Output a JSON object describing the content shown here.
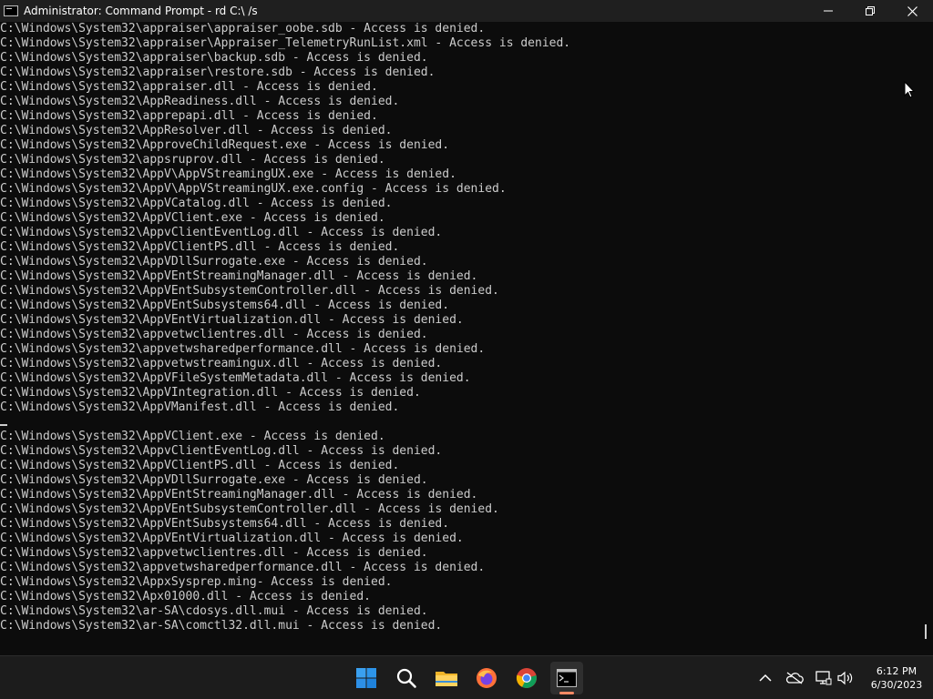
{
  "window": {
    "title": "Administrator: Command Prompt - rd  C:\\ /s",
    "controls": [
      "minimize-icon",
      "maximize-icon",
      "close-icon"
    ]
  },
  "console": {
    "lines_block1": [
      "C:\\Windows\\System32\\appraiser\\appraiser_oobe.sdb - Access is denied.",
      "C:\\Windows\\System32\\appraiser\\Appraiser_TelemetryRunList.xml - Access is denied.",
      "C:\\Windows\\System32\\appraiser\\backup.sdb - Access is denied.",
      "C:\\Windows\\System32\\appraiser\\restore.sdb - Access is denied.",
      "C:\\Windows\\System32\\appraiser.dll - Access is denied.",
      "C:\\Windows\\System32\\AppReadiness.dll - Access is denied.",
      "C:\\Windows\\System32\\apprepapi.dll - Access is denied.",
      "C:\\Windows\\System32\\AppResolver.dll - Access is denied.",
      "C:\\Windows\\System32\\ApproveChildRequest.exe - Access is denied.",
      "C:\\Windows\\System32\\appsruprov.dll - Access is denied.",
      "C:\\Windows\\System32\\AppV\\AppVStreamingUX.exe - Access is denied.",
      "C:\\Windows\\System32\\AppV\\AppVStreamingUX.exe.config - Access is denied.",
      "C:\\Windows\\System32\\AppVCatalog.dll - Access is denied.",
      "C:\\Windows\\System32\\AppVClient.exe - Access is denied.",
      "C:\\Windows\\System32\\AppvClientEventLog.dll - Access is denied.",
      "C:\\Windows\\System32\\AppVClientPS.dll - Access is denied.",
      "C:\\Windows\\System32\\AppVDllSurrogate.exe - Access is denied.",
      "C:\\Windows\\System32\\AppVEntStreamingManager.dll - Access is denied.",
      "C:\\Windows\\System32\\AppVEntSubsystemController.dll - Access is denied.",
      "C:\\Windows\\System32\\AppVEntSubsystems64.dll - Access is denied.",
      "C:\\Windows\\System32\\AppVEntVirtualization.dll - Access is denied.",
      "C:\\Windows\\System32\\appvetwclientres.dll - Access is denied.",
      "C:\\Windows\\System32\\appvetwsharedperformance.dll - Access is denied.",
      "C:\\Windows\\System32\\appvetwstreamingux.dll - Access is denied.",
      "C:\\Windows\\System32\\AppVFileSystemMetadata.dll - Access is denied.",
      "C:\\Windows\\System32\\AppVIntegration.dll - Access is denied.",
      "C:\\Windows\\System32\\AppVManifest.dll - Access is denied."
    ],
    "lines_block2": [
      "C:\\Windows\\System32\\AppVClient.exe - Access is denied.",
      "C:\\Windows\\System32\\AppvClientEventLog.dll - Access is denied.",
      "C:\\Windows\\System32\\AppVClientPS.dll - Access is denied.",
      "C:\\Windows\\System32\\AppVDllSurrogate.exe - Access is denied.",
      "C:\\Windows\\System32\\AppVEntStreamingManager.dll - Access is denied.",
      "C:\\Windows\\System32\\AppVEntSubsystemController.dll - Access is denied.",
      "C:\\Windows\\System32\\AppVEntSubsystems64.dll - Access is denied.",
      "C:\\Windows\\System32\\AppVEntVirtualization.dll - Access is denied.",
      "C:\\Windows\\System32\\appvetwclientres.dll - Access is denied.",
      "C:\\Windows\\System32\\appvetwsharedperformance.dll - Access is denied.",
      "C:\\Windows\\System32\\AppxSysprep.ming- Access is denied.",
      "C:\\Windows\\System32\\Apx01000.dll - Access is denied.",
      "C:\\Windows\\System32\\ar-SA\\cdosys.dll.mui - Access is denied.",
      "C:\\Windows\\System32\\ar-SA\\comctl32.dll.mui - Access is denied."
    ]
  },
  "taskbar": {
    "apps": [
      "windows-start-icon",
      "search-icon",
      "file-explorer-icon",
      "firefox-icon",
      "chrome-icon",
      "command-prompt-icon"
    ],
    "tray": [
      "chevron-up-icon",
      "onedrive-icon",
      "network-icon",
      "volume-icon"
    ],
    "time": "6:12 PM",
    "date": "6/30/2023"
  },
  "colors": {
    "console_bg": "#0c0c0c",
    "console_text": "#cccccc",
    "titlebar_bg": "#1f1f1f",
    "taskbar_bg": "#1c1c1c",
    "active_indicator": "#ff8a65"
  }
}
